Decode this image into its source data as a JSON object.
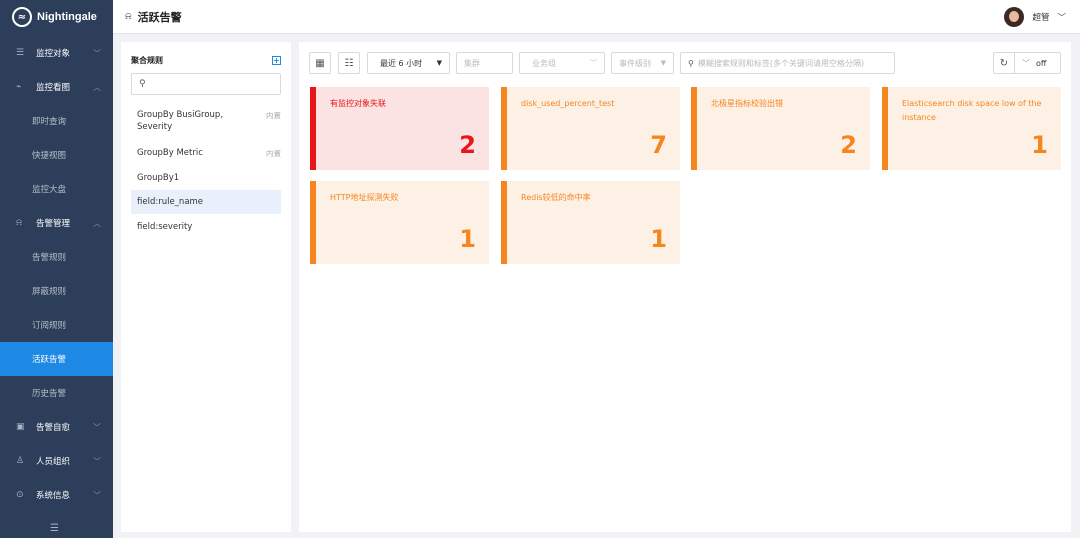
{
  "app": {
    "name": "Nightingale"
  },
  "page": {
    "title": "活跃告警"
  },
  "user": {
    "name": "超管"
  },
  "sidebar": {
    "items": [
      {
        "label": "监控对象",
        "icon": "list-icon",
        "type": "group",
        "expanded": false
      },
      {
        "label": "监控看图",
        "icon": "chart-icon",
        "type": "group",
        "expanded": true
      },
      {
        "label": "即时查询",
        "type": "sub"
      },
      {
        "label": "快捷视图",
        "type": "sub"
      },
      {
        "label": "监控大盘",
        "type": "sub"
      },
      {
        "label": "告警管理",
        "icon": "bell-icon",
        "type": "group",
        "expanded": true
      },
      {
        "label": "告警规则",
        "type": "sub"
      },
      {
        "label": "屏蔽规则",
        "type": "sub"
      },
      {
        "label": "订阅规则",
        "type": "sub"
      },
      {
        "label": "活跃告警",
        "type": "sub",
        "active": true
      },
      {
        "label": "历史告警",
        "type": "sub"
      },
      {
        "label": "告警自愈",
        "icon": "heal-icon",
        "type": "group",
        "expanded": false
      },
      {
        "label": "人员组织",
        "icon": "user-icon",
        "type": "group",
        "expanded": false
      },
      {
        "label": "系统信息",
        "icon": "info-icon",
        "type": "group",
        "expanded": false
      }
    ]
  },
  "aggregation": {
    "title": "聚合规则",
    "rules": [
      {
        "label": "GroupBy BusiGroup, Severity",
        "tag": "内置"
      },
      {
        "label": "GroupBy Metric",
        "tag": "内置"
      },
      {
        "label": "GroupBy1",
        "tag": ""
      },
      {
        "label": "field:rule_name",
        "tag": "",
        "selected": true
      },
      {
        "label": "field:severity",
        "tag": ""
      }
    ]
  },
  "toolbar": {
    "time_range": "最近 6 小时",
    "cluster_placeholder": "集群",
    "busi_group_placeholder": "业务组",
    "severity_placeholder": "事件级别",
    "search_placeholder": "模糊搜索规则和标签(多个关键词请用空格分隔)",
    "refresh_value": "off"
  },
  "cards": [
    {
      "title": "有监控对象失联",
      "count": "2",
      "level": "critical"
    },
    {
      "title": "disk_used_percent_test",
      "count": "7",
      "level": "warning"
    },
    {
      "title": "北极星指标校验出错",
      "count": "2",
      "level": "warning"
    },
    {
      "title": "Elasticsearch disk space low of the instance",
      "count": "1",
      "level": "warning"
    },
    {
      "title": "HTTP地址探测失败",
      "count": "1",
      "level": "warning"
    },
    {
      "title": "Redis较低的命中率",
      "count": "1",
      "level": "warning"
    }
  ],
  "colors": {
    "sidebar_bg": "#2c3e5a",
    "active_blue": "#1e88e5",
    "critical_red": "#e8151b",
    "warning_orange": "#f5861f"
  }
}
